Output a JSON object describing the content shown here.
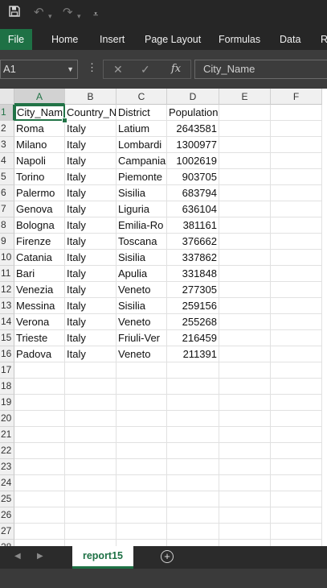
{
  "ribbon": {
    "tabs": [
      "File",
      "Home",
      "Insert",
      "Page Layout",
      "Formulas",
      "Data",
      "Re"
    ]
  },
  "formula_bar": {
    "name_box": "A1",
    "fx_label": "fx",
    "content": "City_Name"
  },
  "grid": {
    "columns": [
      "A",
      "B",
      "C",
      "D",
      "E",
      "F"
    ],
    "rows": [
      [
        "City_Nam",
        "Country_N",
        "District",
        "Population"
      ],
      [
        "Roma",
        "Italy",
        "Latium",
        "2643581"
      ],
      [
        "Milano",
        "Italy",
        "Lombardi",
        "1300977"
      ],
      [
        "Napoli",
        "Italy",
        "Campania",
        "1002619"
      ],
      [
        "Torino",
        "Italy",
        "Piemonte",
        "903705"
      ],
      [
        "Palermo",
        "Italy",
        "Sisilia",
        "683794"
      ],
      [
        "Genova",
        "Italy",
        "Liguria",
        "636104"
      ],
      [
        "Bologna",
        "Italy",
        "Emilia-Ro",
        "381161"
      ],
      [
        "Firenze",
        "Italy",
        "Toscana",
        "376662"
      ],
      [
        "Catania",
        "Italy",
        "Sisilia",
        "337862"
      ],
      [
        "Bari",
        "Italy",
        "Apulia",
        "331848"
      ],
      [
        "Venezia",
        "Italy",
        "Veneto",
        "277305"
      ],
      [
        "Messina",
        "Italy",
        "Sisilia",
        "259156"
      ],
      [
        "Verona",
        "Italy",
        "Veneto",
        "255268"
      ],
      [
        "Trieste",
        "Italy",
        "Friuli-Ver",
        "216459"
      ],
      [
        "Padova",
        "Italy",
        "Veneto",
        "211391"
      ]
    ],
    "total_rows": 28
  },
  "sheets": {
    "active": "report15"
  },
  "colors": {
    "accent": "#217346",
    "chrome": "#262626"
  }
}
